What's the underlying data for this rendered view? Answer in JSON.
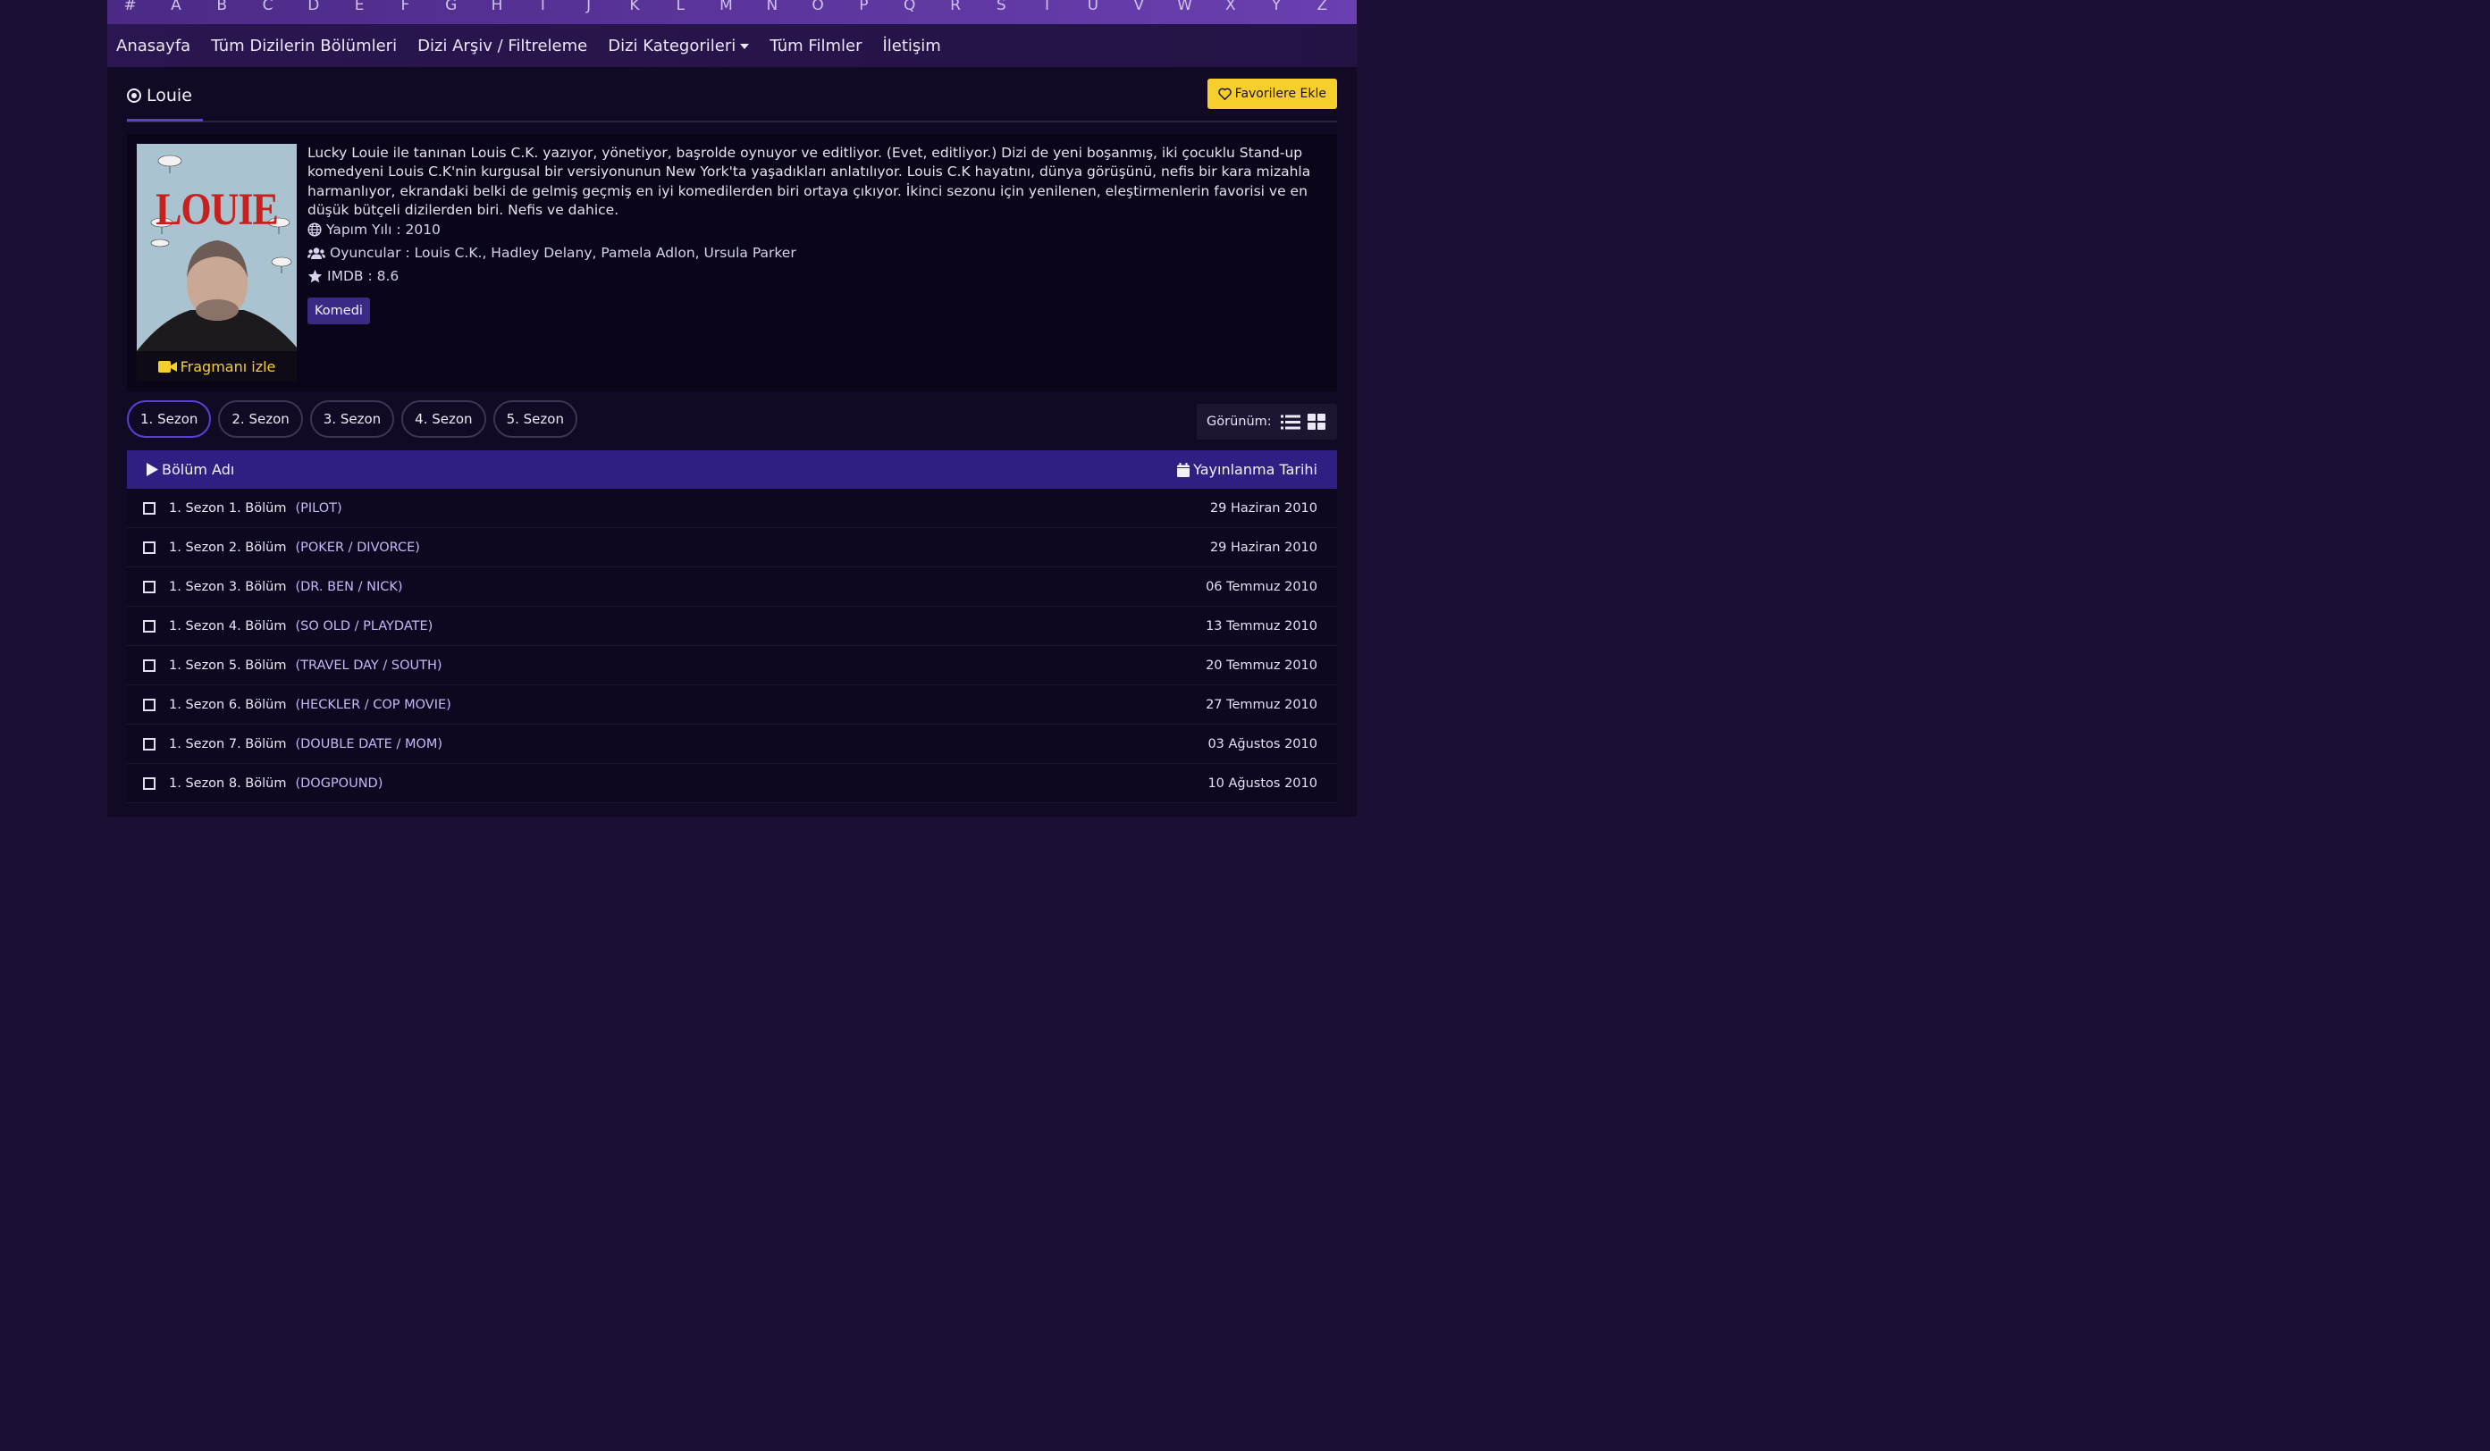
{
  "alphabet": [
    "#",
    "A",
    "B",
    "C",
    "D",
    "E",
    "F",
    "G",
    "H",
    "I",
    "J",
    "K",
    "L",
    "M",
    "N",
    "O",
    "P",
    "Q",
    "R",
    "S",
    "T",
    "U",
    "V",
    "W",
    "X",
    "Y",
    "Z"
  ],
  "nav": {
    "home": "Anasayfa",
    "all_episodes": "Tüm Dizilerin Bölümleri",
    "archive": "Dizi Arşiv / Filtreleme",
    "categories": "Dizi Kategorileri",
    "movies": "Tüm Filmler",
    "contact": "İletişim"
  },
  "title": "Louie",
  "favorite_button": "Favorilere Ekle",
  "poster": {
    "word": "LOUIE",
    "trailer_label": "Fragmanı izle"
  },
  "description": "Lucky Louie ile tanınan Louis C.K. yazıyor, yönetiyor, başrolde oynuyor ve editliyor. (Evet, editliyor.) Dizi de yeni boşanmış, iki çocuklu Stand-up komedyeni Louis C.K'nin kurgusal bir versiyonunun New York'ta yaşadıkları anlatılıyor. Louis C.K hayatını, dünya görüşünü, nefis bir kara mizahla harmanlıyor, ekrandaki belki de gelmiş geçmiş en iyi komedilerden biri ortaya çıkıyor. İkinci sezonu için yenilenen, eleştirmenlerin favorisi ve en düşük bütçeli dizilerden biri. Nefis ve dahice.",
  "meta": {
    "year": "Yapım Yılı : 2010",
    "cast": "Oyuncular : Louis C.K., Hadley Delany, Pamela Adlon, Ursula Parker",
    "imdb": "IMDB : 8.6"
  },
  "genre": "Komedi",
  "seasons": [
    "1. Sezon",
    "2. Sezon",
    "3. Sezon",
    "4. Sezon",
    "5. Sezon"
  ],
  "active_season": "1. Sezon",
  "view_label": "Görünüm:",
  "table": {
    "col_name": "Bölüm Adı",
    "col_date": "Yayınlanma Tarihi",
    "rows": [
      {
        "ep": "1. Sezon 1. Bölüm",
        "name": "(PILOT)",
        "date": "29 Haziran 2010"
      },
      {
        "ep": "1. Sezon 2. Bölüm",
        "name": "(POKER / DIVORCE)",
        "date": "29 Haziran 2010"
      },
      {
        "ep": "1. Sezon 3. Bölüm",
        "name": "(DR. BEN / NICK)",
        "date": "06 Temmuz 2010"
      },
      {
        "ep": "1. Sezon 4. Bölüm",
        "name": "(SO OLD / PLAYDATE)",
        "date": "13 Temmuz 2010"
      },
      {
        "ep": "1. Sezon 5. Bölüm",
        "name": "(TRAVEL DAY / SOUTH)",
        "date": "20 Temmuz 2010"
      },
      {
        "ep": "1. Sezon 6. Bölüm",
        "name": "(HECKLER / COP MOVIE)",
        "date": "27 Temmuz 2010"
      },
      {
        "ep": "1. Sezon 7. Bölüm",
        "name": "(DOUBLE DATE / MOM)",
        "date": "03 Ağustos 2010"
      },
      {
        "ep": "1. Sezon 8. Bölüm",
        "name": "(DOGPOUND)",
        "date": "10 Ağustos 2010"
      }
    ]
  },
  "colors": {
    "accent": "#5a3fd6",
    "header_bar": "#2f1f82",
    "favorite": "#f7cf2c",
    "background": "#1b0f33"
  }
}
